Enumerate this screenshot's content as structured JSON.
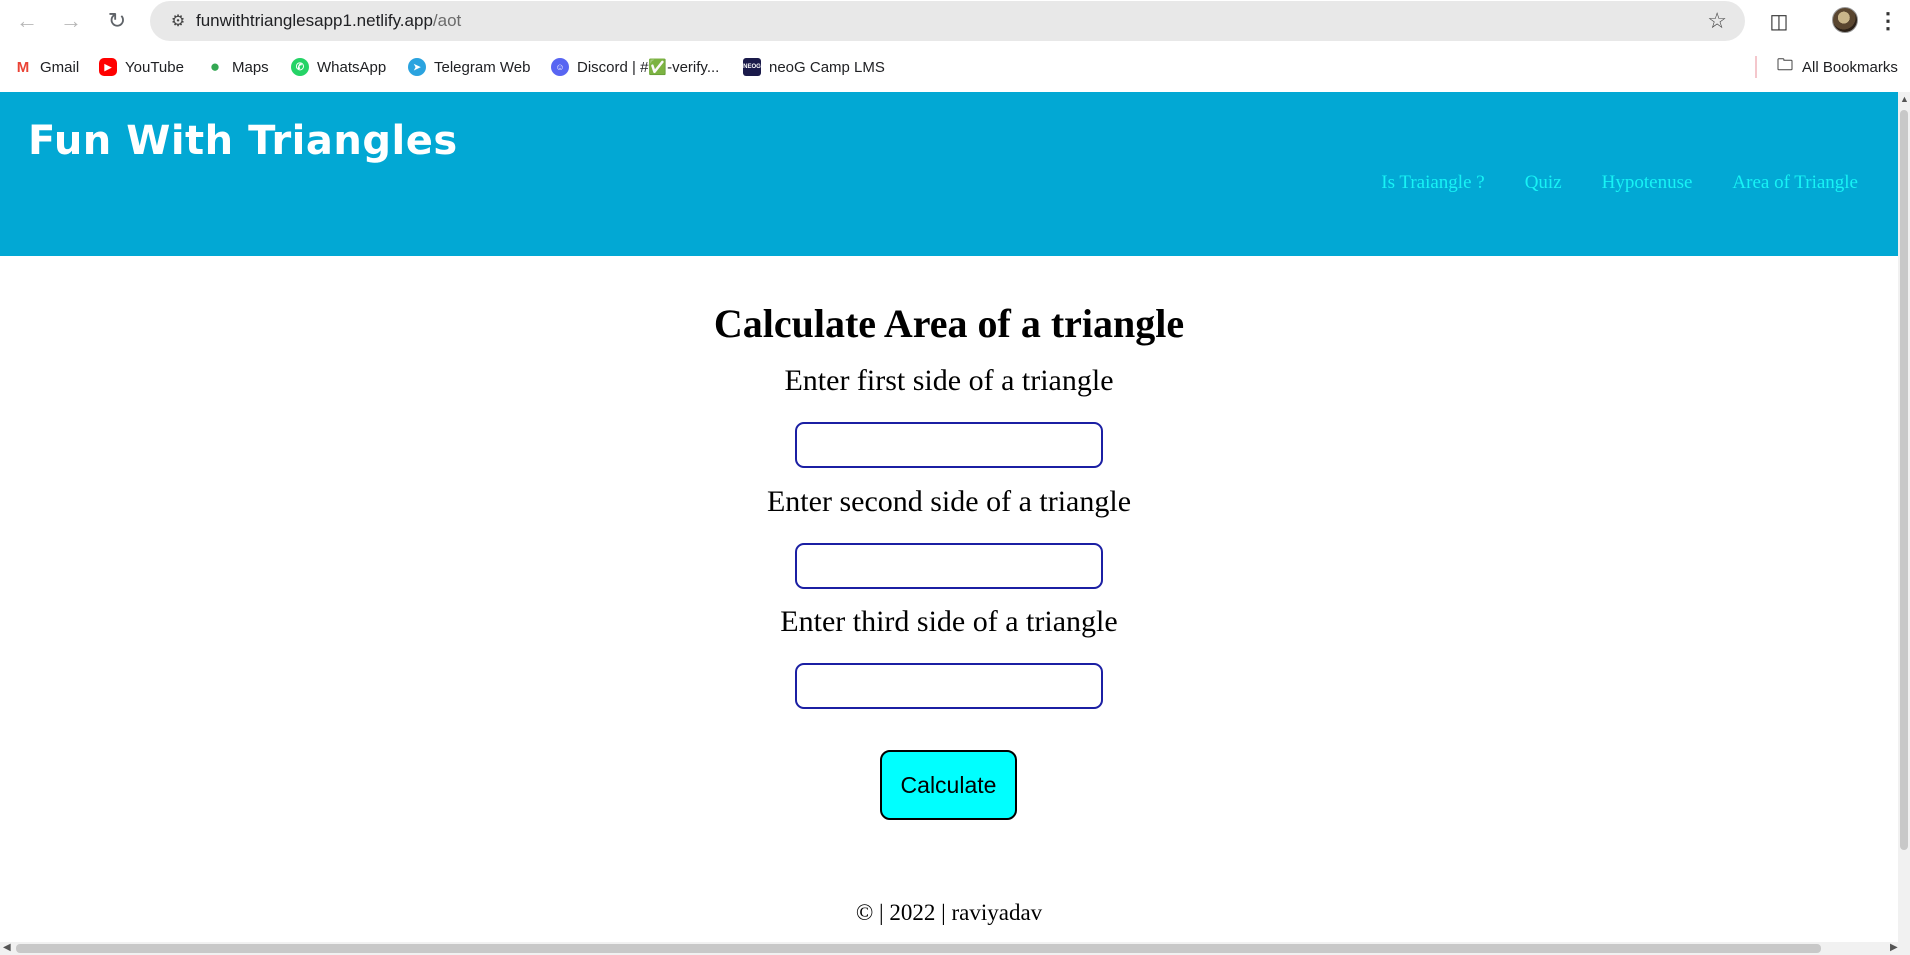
{
  "browser": {
    "url_host": "funwithtrianglesapp1.netlify.app",
    "url_path": "/aot",
    "bookmarks": [
      {
        "label": "Gmail",
        "icon": "gmail-icon",
        "color": "#ea4335"
      },
      {
        "label": "YouTube",
        "icon": "youtube-icon",
        "color": "#ff0000"
      },
      {
        "label": "Maps",
        "icon": "maps-icon",
        "color": "#34a853"
      },
      {
        "label": "WhatsApp",
        "icon": "whatsapp-icon",
        "color": "#25d366"
      },
      {
        "label": "Telegram Web",
        "icon": "telegram-icon",
        "color": "#2aa3df"
      },
      {
        "label": "Discord | #✅-verify...",
        "icon": "discord-icon",
        "color": "#5865f2"
      },
      {
        "label": "neoG Camp LMS",
        "icon": "neog-icon",
        "color": "#1a1a4a"
      }
    ],
    "all_bookmarks_label": "All Bookmarks"
  },
  "header": {
    "title": "Fun With Triangles",
    "nav": [
      "Is Traiangle ?",
      "Quiz",
      "Hypotenuse",
      "Area of Triangle"
    ],
    "background": "#02a8d4",
    "nav_color": "#17f3f5"
  },
  "main": {
    "heading": "Calculate Area of a triangle",
    "first_label": "Enter first side of a triangle",
    "second_label": "Enter second side of a triangle",
    "third_label": "Enter third side of a triangle",
    "first_value": "",
    "second_value": "",
    "third_value": "",
    "button_label": "Calculate",
    "button_color": "#00ffff"
  },
  "footer": {
    "text": "© | 2022 | raviyadav"
  }
}
